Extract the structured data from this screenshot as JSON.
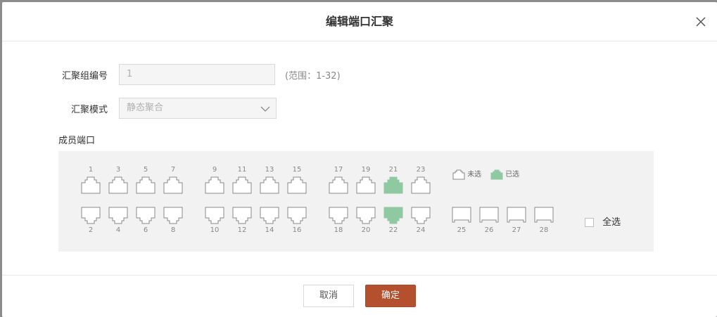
{
  "dialog": {
    "title": "编辑端口汇聚",
    "close_icon": "close-icon"
  },
  "form": {
    "group_label": "汇聚组编号",
    "group_value": "1",
    "range_hint": "(范围：1-32)",
    "mode_label": "汇聚模式",
    "mode_value": "静态聚合",
    "members_label": "成员端口"
  },
  "ports": {
    "top_row": [
      "1",
      "3",
      "5",
      "7",
      "9",
      "11",
      "13",
      "15",
      "17",
      "19",
      "21",
      "23"
    ],
    "bottom_row": [
      "2",
      "4",
      "6",
      "8",
      "10",
      "12",
      "14",
      "16",
      "18",
      "20",
      "22",
      "24"
    ],
    "sfp_row": [
      "25",
      "26",
      "27",
      "28"
    ],
    "selected": [
      "21",
      "22"
    ],
    "unselected_color": "#ffffff",
    "selected_color": "#8fc9a2"
  },
  "legend": {
    "unselected_label": "未选",
    "selected_label": "已选"
  },
  "select_all_label": "全选",
  "buttons": {
    "cancel_label": "取消",
    "ok_label": "确定"
  }
}
